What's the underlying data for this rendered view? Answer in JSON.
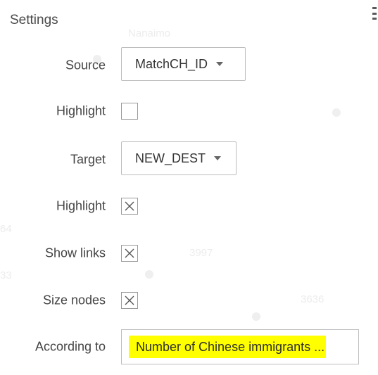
{
  "panel": {
    "title": "Settings"
  },
  "background_map": {
    "labels": [
      "Nanaimo",
      "3997",
      "3636",
      "64",
      "33"
    ]
  },
  "form": {
    "source": {
      "label": "Source",
      "value": "MatchCH_ID"
    },
    "source_highlight": {
      "label": "Highlight",
      "checked": false
    },
    "target": {
      "label": "Target",
      "value": "NEW_DEST"
    },
    "target_highlight": {
      "label": "Highlight",
      "checked": true
    },
    "show_links": {
      "label": "Show links",
      "checked": true
    },
    "size_nodes": {
      "label": "Size nodes",
      "checked": true
    },
    "according_to": {
      "label": "According to",
      "value": "Number of Chinese immigrants ..."
    }
  },
  "colors": {
    "highlight": "#ffff00",
    "border": "#bdbdbd",
    "text": "#444444"
  }
}
